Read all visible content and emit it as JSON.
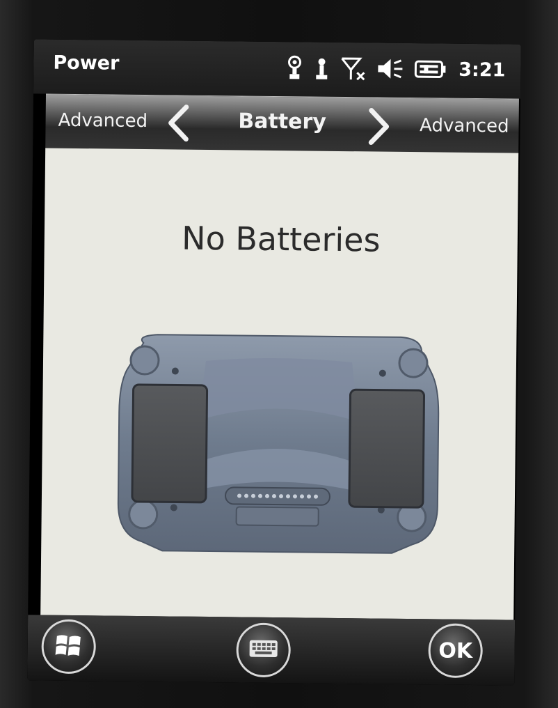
{
  "status_bar": {
    "title": "Power",
    "time": "3:21",
    "icons": [
      "connectivity-icon",
      "person-icon",
      "signal-off-icon",
      "speaker-muted-icon",
      "battery-charging-icon"
    ]
  },
  "nav": {
    "prev_label": "Advanced",
    "title": "Battery",
    "next_label": "Advanced",
    "prev_icon": "chevron-left-icon",
    "next_icon": "chevron-right-icon"
  },
  "content": {
    "message": "No Batteries",
    "graphic": "battery-bay-graphic"
  },
  "soft_keys": {
    "start_icon": "windows-logo-icon",
    "keyboard_icon": "keyboard-icon",
    "ok_label": "OK"
  }
}
